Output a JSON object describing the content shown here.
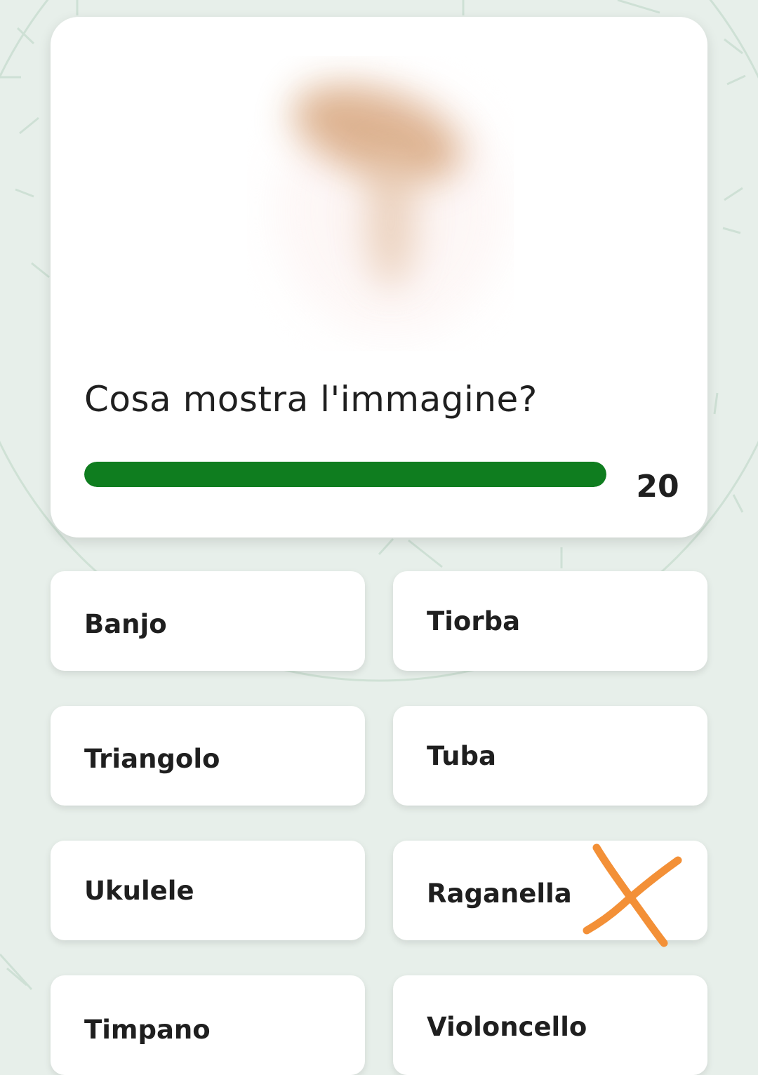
{
  "question": {
    "text": "Cosa mostra l'immagine?",
    "image": "blurred-image"
  },
  "timer": {
    "seconds_label": "20",
    "fill_fraction": 1.0,
    "color": "#0f7d1f"
  },
  "answers": [
    {
      "label": "Banjo"
    },
    {
      "label": "Tiorba"
    },
    {
      "label": "Triangolo"
    },
    {
      "label": "Tuba"
    },
    {
      "label": "Ukulele"
    },
    {
      "label": "Raganella",
      "marked": "cross-mark-icon"
    },
    {
      "label": "Timpano"
    },
    {
      "label": "Violoncello"
    }
  ],
  "colors": {
    "background": "#e7efea",
    "card": "#ffffff",
    "text": "#1f1f1f",
    "cross_mark": "#f39037"
  }
}
